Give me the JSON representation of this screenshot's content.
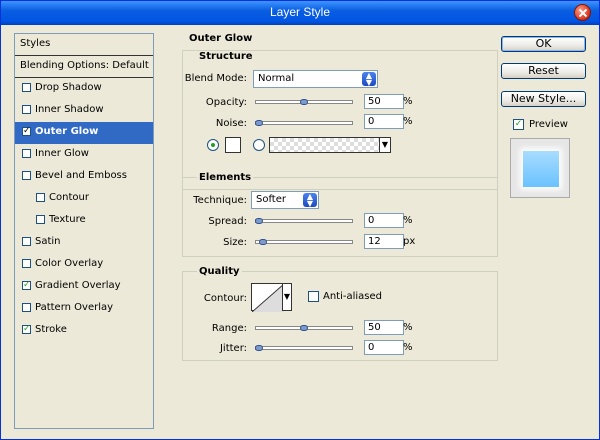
{
  "window": {
    "title": "Layer Style"
  },
  "sidebar": {
    "items": [
      {
        "label": "Styles",
        "checked": null
      },
      {
        "label": "Blending Options: Default",
        "checked": null
      },
      {
        "label": "Drop Shadow",
        "checked": false
      },
      {
        "label": "Inner Shadow",
        "checked": false
      },
      {
        "label": "Outer Glow",
        "checked": true,
        "selected": true
      },
      {
        "label": "Inner Glow",
        "checked": false
      },
      {
        "label": "Bevel and Emboss",
        "checked": false
      },
      {
        "label": "Contour",
        "checked": false
      },
      {
        "label": "Texture",
        "checked": false
      },
      {
        "label": "Satin",
        "checked": false
      },
      {
        "label": "Color Overlay",
        "checked": false
      },
      {
        "label": "Gradient Overlay",
        "checked": true
      },
      {
        "label": "Pattern Overlay",
        "checked": false
      },
      {
        "label": "Stroke",
        "checked": true
      }
    ]
  },
  "panel": {
    "heading": "Outer Glow",
    "structure": {
      "title": "Structure",
      "blend_mode_label": "Blend Mode:",
      "blend_mode_value": "Normal",
      "opacity_label": "Opacity:",
      "opacity_value": "50",
      "opacity_level": 0.5,
      "noise_label": "Noise:",
      "noise_value": "0",
      "noise_level": 0.0,
      "unit": "%",
      "color_mode": "solid",
      "swatch_color": "#ffffff"
    },
    "elements": {
      "title": "Elements",
      "technique_label": "Technique:",
      "technique_value": "Softer",
      "spread_label": "Spread:",
      "spread_value": "0",
      "spread_unit": "%",
      "spread_level": 0.0,
      "size_label": "Size:",
      "size_value": "12",
      "size_unit": "px",
      "size_level": 0.04
    },
    "quality": {
      "title": "Quality",
      "contour_label": "Contour:",
      "anti_aliased_label": "Anti-aliased",
      "anti_aliased_checked": false,
      "range_label": "Range:",
      "range_value": "50",
      "range_level": 0.5,
      "jitter_label": "Jitter:",
      "jitter_value": "0",
      "jitter_level": 0.0,
      "unit": "%"
    }
  },
  "buttons": {
    "ok": "OK",
    "reset": "Reset",
    "new_style": "New Style...",
    "preview_label": "Preview",
    "preview_checked": true
  },
  "colors": {
    "titlebar": "#0054e3",
    "selection": "#316ac5",
    "preview_fill": "#6ac2ff"
  }
}
